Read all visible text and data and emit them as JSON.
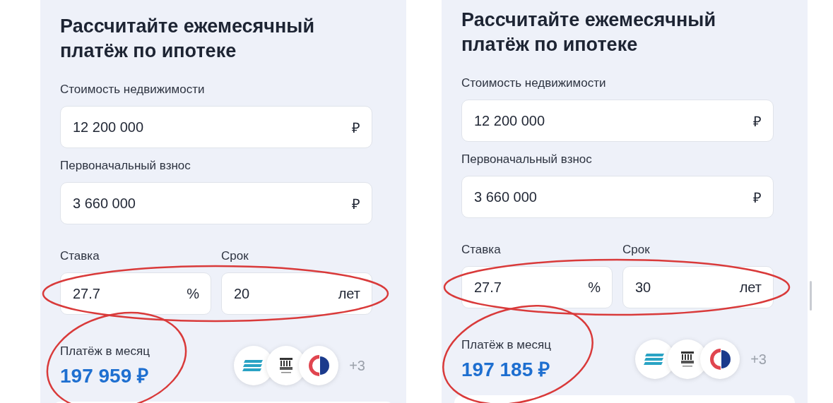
{
  "panels": [
    {
      "title": "Рассчитайте ежемесячный платёж по ипотеке",
      "fields": [
        {
          "kind": "full",
          "label": "Стоимость недвижимости",
          "value": "12 200 000",
          "unit": "₽"
        },
        {
          "kind": "full",
          "label": "Первоначальный взнос",
          "value": "3 660 000",
          "unit": "₽"
        },
        {
          "kind": "half",
          "label": "Ставка",
          "value": "27.7",
          "unit": "%"
        },
        {
          "kind": "half",
          "label": "Срок",
          "value": "20",
          "unit": "лет"
        }
      ],
      "payment": {
        "label": "Платёж в месяц",
        "amount": "197 959 ₽"
      },
      "more_banks": "+3"
    },
    {
      "title": "Рассчитайте ежемесячный платёж по ипотеке",
      "fields": [
        {
          "kind": "full",
          "label": "Стоимость недвижимости",
          "value": "12 200 000",
          "unit": "₽"
        },
        {
          "kind": "full",
          "label": "Первоначальный взнос",
          "value": "3 660 000",
          "unit": "₽"
        },
        {
          "kind": "half",
          "label": "Ставка",
          "value": "27.7",
          "unit": "%"
        },
        {
          "kind": "half",
          "label": "Срок",
          "value": "30",
          "unit": "лет"
        }
      ],
      "payment": {
        "label": "Платёж в месяц",
        "amount": "197 185 ₽"
      },
      "more_banks": "+3"
    }
  ]
}
